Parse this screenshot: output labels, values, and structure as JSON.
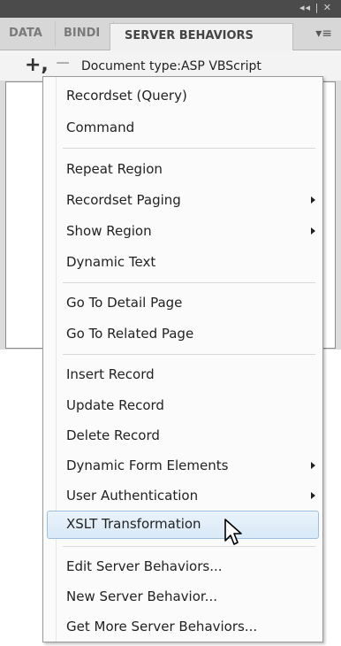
{
  "panel": {
    "titlebar_controls": "◂◂ | ✕",
    "tabs": [
      "DATA",
      "BINDI",
      "SERVER BEHAVIORS"
    ],
    "menu_icon": "▾≡",
    "toolbar": {
      "plus": "+,",
      "minus": "−",
      "doc_type": "Document type:ASP VBScript"
    }
  },
  "menu": {
    "items": [
      {
        "label": "Recordset (Query)",
        "submenu": false
      },
      {
        "label": "Command",
        "submenu": false
      },
      {
        "label": "Repeat Region",
        "submenu": false
      },
      {
        "label": "Recordset Paging",
        "submenu": true
      },
      {
        "label": "Show Region",
        "submenu": true
      },
      {
        "label": "Dynamic Text",
        "submenu": false
      },
      {
        "label": "Go To Detail Page",
        "submenu": false
      },
      {
        "label": "Go To Related Page",
        "submenu": false
      },
      {
        "label": "Insert Record",
        "submenu": false
      },
      {
        "label": "Update Record",
        "submenu": false
      },
      {
        "label": "Delete Record",
        "submenu": false
      },
      {
        "label": "Dynamic Form Elements",
        "submenu": true
      },
      {
        "label": "User Authentication",
        "submenu": true
      },
      {
        "label": "XSLT Transformation",
        "submenu": false,
        "highlighted": true
      },
      {
        "label": "Edit Server Behaviors...",
        "submenu": false
      },
      {
        "label": "New Server Behavior...",
        "submenu": false
      },
      {
        "label": "Get More Server Behaviors...",
        "submenu": false
      }
    ]
  },
  "colors": {
    "highlight": "#d9e9f7",
    "highlight_border": "#9cc1e0"
  }
}
